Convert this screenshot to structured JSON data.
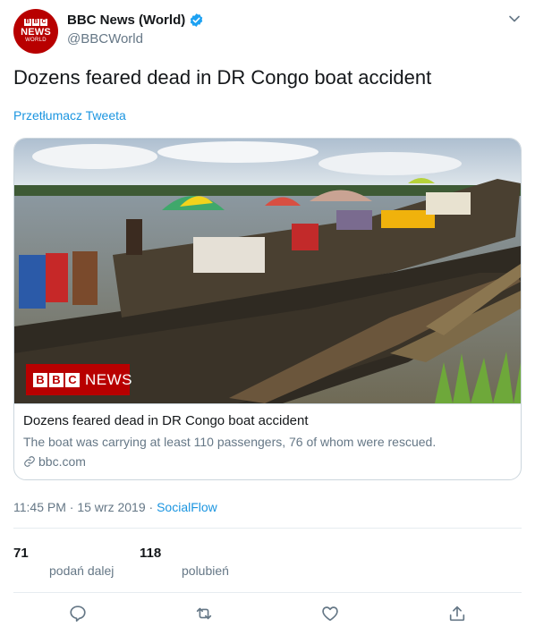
{
  "account": {
    "avatar_line1": [
      "B",
      "B",
      "C"
    ],
    "avatar_line2": "NEWS",
    "avatar_line3": "WORLD",
    "display_name": "BBC News (World)",
    "handle": "@BBCWorld",
    "verified": true
  },
  "tweet": {
    "text": "Dozens feared dead in DR Congo boat accident",
    "translate_label": "Przetłumacz Tweeta"
  },
  "card": {
    "image_badge_blocks": [
      "B",
      "B",
      "C"
    ],
    "image_badge_text": "NEWS",
    "title": "Dozens feared dead in DR Congo boat accident",
    "description": "The boat was carrying at least 110 passengers, 76 of whom were rescued.",
    "domain": "bbc.com"
  },
  "meta": {
    "time": "11:45 PM",
    "sep1": " · ",
    "date": "15 wrz 2019",
    "sep2": " · ",
    "source": "SocialFlow"
  },
  "stats": {
    "retweets": "71",
    "retweets_label": "podań dalej",
    "likes": "118",
    "likes_label": "polubień"
  },
  "icons": {
    "reply": "reply-icon",
    "retweet": "retweet-icon",
    "like": "heart-icon",
    "share": "share-icon",
    "verified": "verified-badge-icon",
    "caret": "chevron-down-icon",
    "link": "link-icon"
  },
  "colors": {
    "brand_red": "#b80000",
    "link_blue": "#1b95e0",
    "muted": "#657786"
  }
}
